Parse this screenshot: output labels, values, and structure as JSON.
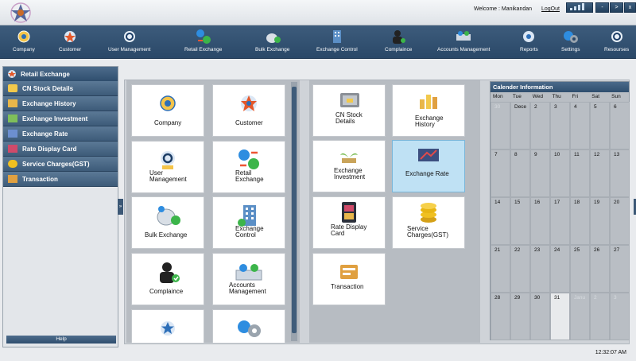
{
  "header": {
    "welcome": "Welcome : Manikandan",
    "logout": "LogOut",
    "buttons": {
      "minimize": "-",
      "maximize": ">",
      "close": "x"
    }
  },
  "toolbar": {
    "items": [
      {
        "label": "Company",
        "icon": "company-icon"
      },
      {
        "label": "Customer",
        "icon": "customer-icon"
      },
      {
        "label": "User Management",
        "icon": "user-management-icon"
      },
      {
        "label": "Retail Exchange",
        "icon": "retail-exchange-icon"
      },
      {
        "label": "Bulk Exchange",
        "icon": "bulk-exchange-icon"
      },
      {
        "label": "Exchange Control",
        "icon": "exchange-control-icon"
      },
      {
        "label": "Complaince",
        "icon": "complaince-icon"
      },
      {
        "label": "Accounts Management",
        "icon": "accounts-management-icon"
      },
      {
        "label": "Reports",
        "icon": "reports-icon"
      },
      {
        "label": "Settings",
        "icon": "settings-icon"
      },
      {
        "label": "Resourses",
        "icon": "resourses-icon"
      }
    ]
  },
  "sidebar": {
    "title": "Retail Exchange",
    "items": [
      {
        "label": "CN Stock Details"
      },
      {
        "label": "Exchange History"
      },
      {
        "label": "Exchange Investment"
      },
      {
        "label": "Exchange Rate"
      },
      {
        "label": "Rate Display Card"
      },
      {
        "label": "Service Charges(GST)"
      },
      {
        "label": "Transaction"
      }
    ],
    "help": "Help"
  },
  "panel_left": {
    "tiles": [
      {
        "label": "Company"
      },
      {
        "label": "Customer"
      },
      {
        "label": "User\nManagement"
      },
      {
        "label": "Retail\nExchange"
      },
      {
        "label": "Bulk Exchange"
      },
      {
        "label": "Exchange\nControl"
      },
      {
        "label": "Complaince"
      },
      {
        "label": "Accounts\nManagement"
      },
      {
        "label": ""
      },
      {
        "label": ""
      }
    ]
  },
  "panel_right": {
    "tiles": [
      {
        "label": "CN Stock\nDetails"
      },
      {
        "label": "Exchange\nHistory"
      },
      {
        "label": "Exchange\nInvestment"
      },
      {
        "label": "Exchange Rate",
        "active": true
      },
      {
        "label": "Rate Display\nCard"
      },
      {
        "label": "Service\nCharges(GST)"
      },
      {
        "label": "Transaction"
      }
    ]
  },
  "calendar": {
    "title": "Calender Information",
    "days_of_week": [
      "Mon",
      "Tue",
      "Wed",
      "Thu",
      "Fri",
      "Sat",
      "Sun"
    ],
    "cells": [
      "30",
      "Dece",
      "2",
      "3",
      "4",
      "5",
      "6",
      "7",
      "8",
      "9",
      "10",
      "11",
      "12",
      "13",
      "14",
      "15",
      "16",
      "17",
      "18",
      "19",
      "20",
      "21",
      "22",
      "23",
      "24",
      "25",
      "26",
      "27",
      "28",
      "29",
      "30",
      "31",
      "Janu",
      "2",
      "3"
    ],
    "muted_indices": [
      0,
      32,
      33,
      34
    ],
    "today_index": 31
  },
  "status": {
    "time": "12:32:07 AM"
  }
}
